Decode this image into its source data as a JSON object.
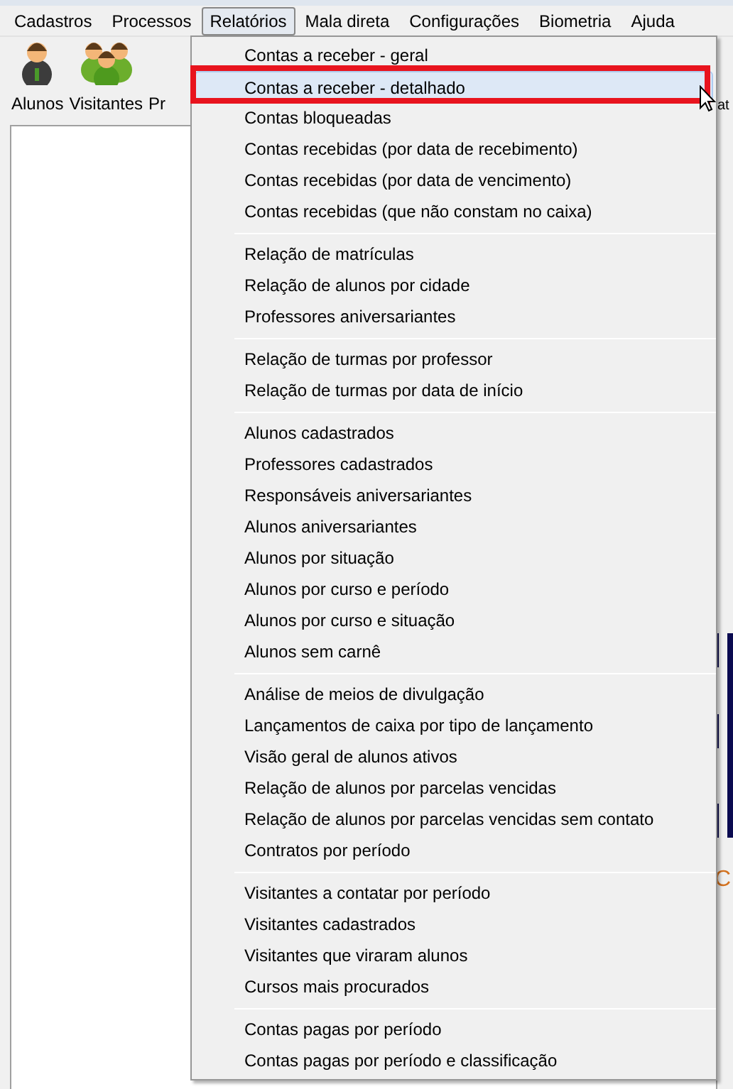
{
  "menu_bar": [
    {
      "label": "Cadastros",
      "selected": false
    },
    {
      "label": "Processos",
      "selected": false
    },
    {
      "label": "Relatórios",
      "selected": true
    },
    {
      "label": "Mala direta",
      "selected": false
    },
    {
      "label": "Configurações",
      "selected": false
    },
    {
      "label": "Biometria",
      "selected": false
    },
    {
      "label": "Ajuda",
      "selected": false
    }
  ],
  "toolbar": [
    {
      "label": "Alunos",
      "kind": "person"
    },
    {
      "label": "Visitantes",
      "kind": "group"
    },
    {
      "label": "Pr",
      "kind": "hidden"
    }
  ],
  "toolbar_right_label": "at",
  "background_letter": "C",
  "dropdown": {
    "groups": [
      [
        {
          "label": "Contas a receber - geral",
          "selected": false
        },
        {
          "label": "Contas a receber - detalhado",
          "selected": true
        },
        {
          "label": "Contas bloqueadas",
          "selected": false
        },
        {
          "label": "Contas recebidas (por data de recebimento)",
          "selected": false
        },
        {
          "label": "Contas recebidas (por data de vencimento)",
          "selected": false
        },
        {
          "label": "Contas recebidas (que não constam no caixa)",
          "selected": false
        }
      ],
      [
        {
          "label": "Relação de matrículas",
          "selected": false
        },
        {
          "label": "Relação de alunos por cidade",
          "selected": false
        },
        {
          "label": "Professores aniversariantes",
          "selected": false
        }
      ],
      [
        {
          "label": "Relação de turmas por professor",
          "selected": false
        },
        {
          "label": "Relação de turmas por data de início",
          "selected": false
        }
      ],
      [
        {
          "label": "Alunos cadastrados",
          "selected": false
        },
        {
          "label": "Professores cadastrados",
          "selected": false
        },
        {
          "label": "Responsáveis aniversariantes",
          "selected": false
        },
        {
          "label": "Alunos aniversariantes",
          "selected": false
        },
        {
          "label": "Alunos por situação",
          "selected": false
        },
        {
          "label": "Alunos por curso e período",
          "selected": false
        },
        {
          "label": "Alunos por curso e situação",
          "selected": false
        },
        {
          "label": "Alunos sem carnê",
          "selected": false
        }
      ],
      [
        {
          "label": "Análise de meios de divulgação",
          "selected": false
        },
        {
          "label": "Lançamentos de caixa por tipo de lançamento",
          "selected": false
        },
        {
          "label": "Visão geral de alunos ativos",
          "selected": false
        },
        {
          "label": "Relação de alunos por parcelas vencidas",
          "selected": false
        },
        {
          "label": "Relação de alunos por parcelas vencidas sem contato",
          "selected": false
        },
        {
          "label": "Contratos por período",
          "selected": false
        }
      ],
      [
        {
          "label": "Visitantes a contatar por período",
          "selected": false
        },
        {
          "label": "Visitantes cadastrados",
          "selected": false
        },
        {
          "label": "Visitantes que viraram alunos",
          "selected": false
        },
        {
          "label": "Cursos mais procurados",
          "selected": false
        }
      ],
      [
        {
          "label": "Contas pagas por período",
          "selected": false
        },
        {
          "label": "Contas pagas por período e classificação",
          "selected": false
        }
      ]
    ]
  }
}
